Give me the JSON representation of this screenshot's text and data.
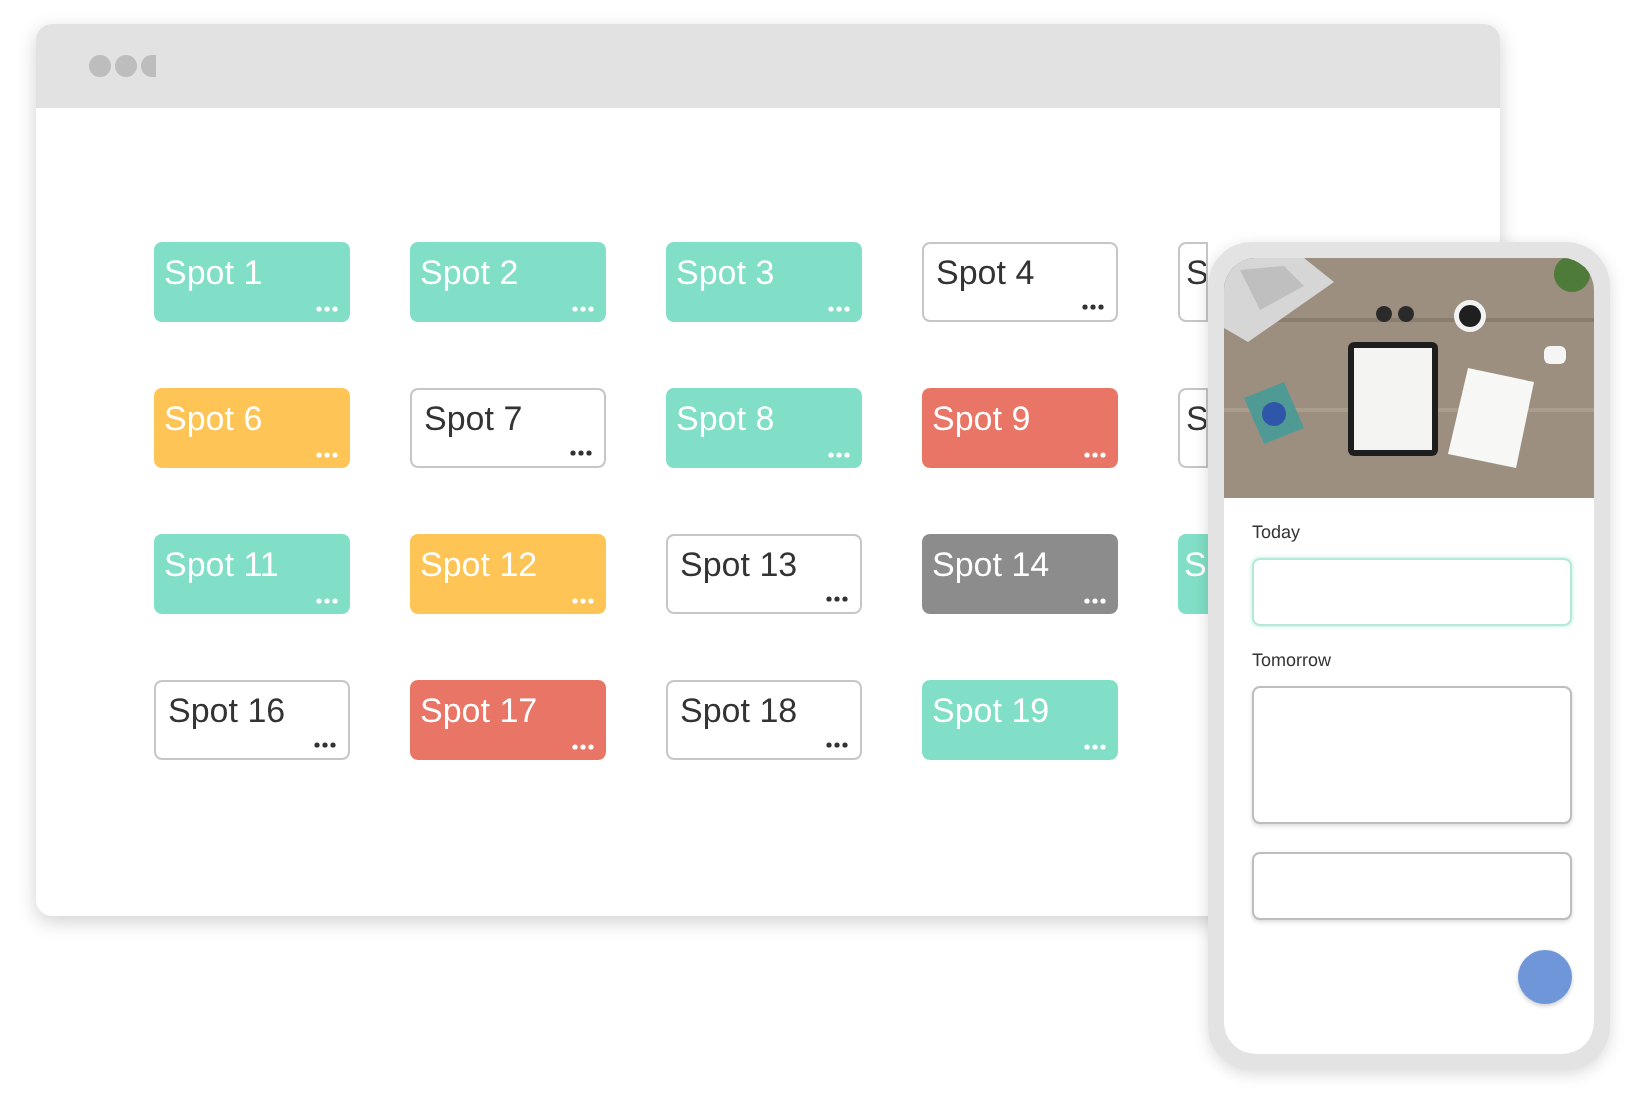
{
  "spots": [
    {
      "label": "Spot 1",
      "kind": "filled",
      "color": "#80dfc6"
    },
    {
      "label": "Spot 2",
      "kind": "filled",
      "color": "#80dfc6"
    },
    {
      "label": "Spot 3",
      "kind": "filled",
      "color": "#80dfc6"
    },
    {
      "label": "Spot 4",
      "kind": "outline",
      "color": "#ffffff"
    },
    {
      "label": "S",
      "kind": "outline",
      "color": "#ffffff"
    },
    {
      "label": "Spot 6",
      "kind": "filled",
      "color": "#fec556"
    },
    {
      "label": "Spot 7",
      "kind": "outline",
      "color": "#ffffff"
    },
    {
      "label": "Spot 8",
      "kind": "filled",
      "color": "#80dfc6"
    },
    {
      "label": "Spot 9",
      "kind": "filled",
      "color": "#e87565"
    },
    {
      "label": "S",
      "kind": "outline",
      "color": "#ffffff"
    },
    {
      "label": "Spot 11",
      "kind": "filled",
      "color": "#80dfc6"
    },
    {
      "label": "Spot 12",
      "kind": "filled",
      "color": "#fec556"
    },
    {
      "label": "Spot 13",
      "kind": "outline",
      "color": "#ffffff"
    },
    {
      "label": "Spot 14",
      "kind": "filled",
      "color": "#8c8c8c"
    },
    {
      "label": "S",
      "kind": "filled",
      "color": "#80dfc6"
    },
    {
      "label": "Spot 16",
      "kind": "outline",
      "color": "#ffffff"
    },
    {
      "label": "Spot 17",
      "kind": "filled",
      "color": "#e87565"
    },
    {
      "label": "Spot 18",
      "kind": "outline",
      "color": "#ffffff"
    },
    {
      "label": "Spot 19",
      "kind": "filled",
      "color": "#80dfc6"
    }
  ],
  "phone": {
    "fields": [
      {
        "label": "Today",
        "kind": "input",
        "focused": true
      },
      {
        "label": "Tomorrow",
        "kind": "textarea",
        "focused": false
      },
      {
        "kind": "input",
        "focused": false
      }
    ]
  }
}
